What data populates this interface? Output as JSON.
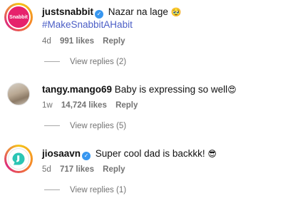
{
  "comments": [
    {
      "username": "justsnabbit",
      "avatar_text": "Snabbit",
      "verified": true,
      "text": "Nazar na lage",
      "emoji": "🥹",
      "hashtag": "#MakeSnabbitAHabit",
      "age": "4d",
      "likes": "991 likes",
      "reply": "Reply",
      "view_replies": "View replies (2)"
    },
    {
      "username": "tangy.mango69",
      "verified": false,
      "text": "Baby is expressing so well",
      "emoji": "😍",
      "age": "1w",
      "likes": "14,724 likes",
      "reply": "Reply",
      "view_replies": "View replies (5)"
    },
    {
      "username": "jiosaavn",
      "verified": true,
      "text": "Super cool dad is backkk!",
      "emoji": "😎",
      "age": "5d",
      "likes": "717 likes",
      "reply": "Reply",
      "view_replies": "View replies (1)"
    }
  ],
  "colors": {
    "verified": "#3897f0",
    "hashtag": "#4b5ec6",
    "meta": "#737373",
    "snabbit_brand": "#e6226c",
    "saavn_brand": "#2bc5b4"
  },
  "icons": {
    "verified": "verified-badge-icon",
    "saavn_logo": "jiosaavn-logo-icon"
  }
}
